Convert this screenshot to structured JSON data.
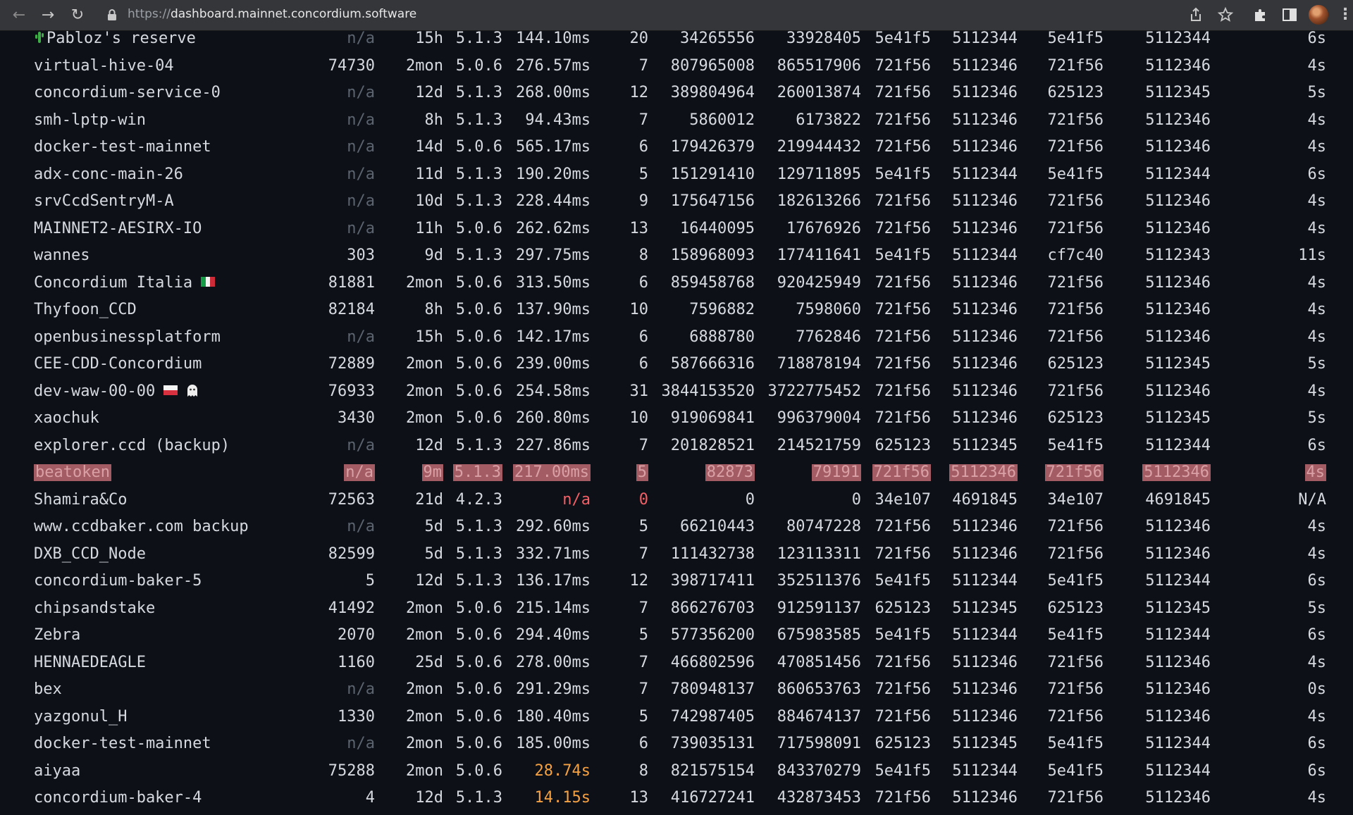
{
  "browser": {
    "url_scheme": "https://",
    "url_host": "dashboard.mainnet.concordium.software"
  },
  "table": {
    "rows": [
      {
        "name": "Pabloz's reserve",
        "icon": "cactus-icon",
        "id": "n/a",
        "uptime": "15h",
        "version": "5.1.3",
        "latency": "144.10ms",
        "peers": "20",
        "sent": "34265556",
        "received": "33928405",
        "best_block": "5e41f5",
        "best_height": "5112344",
        "final_block": "5e41f5",
        "final_height": "5112344",
        "age": "6s"
      },
      {
        "name": "virtual-hive-04",
        "id": "74730",
        "uptime": "2mon",
        "version": "5.0.6",
        "latency": "276.57ms",
        "peers": "7",
        "sent": "807965008",
        "received": "865517906",
        "best_block": "721f56",
        "best_height": "5112346",
        "final_block": "721f56",
        "final_height": "5112346",
        "age": "4s"
      },
      {
        "name": "concordium-service-0",
        "id": "n/a",
        "uptime": "12d",
        "version": "5.1.3",
        "latency": "268.00ms",
        "peers": "12",
        "sent": "389804964",
        "received": "260013874",
        "best_block": "721f56",
        "best_height": "5112346",
        "final_block": "625123",
        "final_height": "5112345",
        "age": "5s"
      },
      {
        "name": "smh-lptp-win",
        "id": "n/a",
        "uptime": "8h",
        "version": "5.1.3",
        "latency": "94.43ms",
        "peers": "7",
        "sent": "5860012",
        "received": "6173822",
        "best_block": "721f56",
        "best_height": "5112346",
        "final_block": "721f56",
        "final_height": "5112346",
        "age": "4s"
      },
      {
        "name": "docker-test-mainnet",
        "id": "n/a",
        "uptime": "14d",
        "version": "5.0.6",
        "latency": "565.17ms",
        "peers": "6",
        "sent": "179426379",
        "received": "219944432",
        "best_block": "721f56",
        "best_height": "5112346",
        "final_block": "721f56",
        "final_height": "5112346",
        "age": "4s"
      },
      {
        "name": "adx-conc-main-26",
        "id": "n/a",
        "uptime": "11d",
        "version": "5.1.3",
        "latency": "190.20ms",
        "peers": "5",
        "sent": "151291410",
        "received": "129711895",
        "best_block": "5e41f5",
        "best_height": "5112344",
        "final_block": "5e41f5",
        "final_height": "5112344",
        "age": "6s"
      },
      {
        "name": "srvCcdSentryM-A",
        "id": "n/a",
        "uptime": "10d",
        "version": "5.1.3",
        "latency": "228.44ms",
        "peers": "9",
        "sent": "175647156",
        "received": "182613266",
        "best_block": "721f56",
        "best_height": "5112346",
        "final_block": "721f56",
        "final_height": "5112346",
        "age": "4s"
      },
      {
        "name": "MAINNET2-AESIRX-IO",
        "id": "n/a",
        "uptime": "11h",
        "version": "5.0.6",
        "latency": "262.62ms",
        "peers": "13",
        "sent": "16440095",
        "received": "17676926",
        "best_block": "721f56",
        "best_height": "5112346",
        "final_block": "721f56",
        "final_height": "5112346",
        "age": "4s"
      },
      {
        "name": "wannes",
        "id": "303",
        "uptime": "9d",
        "version": "5.1.3",
        "latency": "297.75ms",
        "peers": "8",
        "sent": "158968093",
        "received": "177411641",
        "best_block": "5e41f5",
        "best_height": "5112344",
        "final_block": "cf7c40",
        "final_height": "5112343",
        "age": "11s"
      },
      {
        "name": "Concordium Italia",
        "flag": "italy-flag-icon",
        "id": "81881",
        "uptime": "2mon",
        "version": "5.0.6",
        "latency": "313.50ms",
        "peers": "6",
        "sent": "859458768",
        "received": "920425949",
        "best_block": "721f56",
        "best_height": "5112346",
        "final_block": "721f56",
        "final_height": "5112346",
        "age": "4s"
      },
      {
        "name": "Thyfoon_CCD",
        "id": "82184",
        "uptime": "8h",
        "version": "5.0.6",
        "latency": "137.90ms",
        "peers": "10",
        "sent": "7596882",
        "received": "7598060",
        "best_block": "721f56",
        "best_height": "5112346",
        "final_block": "721f56",
        "final_height": "5112346",
        "age": "4s"
      },
      {
        "name": "openbusinessplatform",
        "id": "n/a",
        "uptime": "15h",
        "version": "5.0.6",
        "latency": "142.17ms",
        "peers": "6",
        "sent": "6888780",
        "received": "7762846",
        "best_block": "721f56",
        "best_height": "5112346",
        "final_block": "721f56",
        "final_height": "5112346",
        "age": "4s"
      },
      {
        "name": "CEE-CDD-Concordium",
        "id": "72889",
        "uptime": "2mon",
        "version": "5.0.6",
        "latency": "239.00ms",
        "peers": "6",
        "sent": "587666316",
        "received": "718878194",
        "best_block": "721f56",
        "best_height": "5112346",
        "final_block": "625123",
        "final_height": "5112345",
        "age": "5s"
      },
      {
        "name": "dev-waw-00-00",
        "flag": "poland-flag-icon",
        "extra_icon": "ghost-icon",
        "id": "76933",
        "uptime": "2mon",
        "version": "5.0.6",
        "latency": "254.58ms",
        "peers": "31",
        "sent": "3844153520",
        "received": "3722775452",
        "best_block": "721f56",
        "best_height": "5112346",
        "final_block": "721f56",
        "final_height": "5112346",
        "age": "4s"
      },
      {
        "name": "xaochuk",
        "id": "3430",
        "uptime": "2mon",
        "version": "5.0.6",
        "latency": "260.80ms",
        "peers": "10",
        "sent": "919069841",
        "received": "996379004",
        "best_block": "721f56",
        "best_height": "5112346",
        "final_block": "625123",
        "final_height": "5112345",
        "age": "5s"
      },
      {
        "name": "explorer.ccd (backup)",
        "id": "n/a",
        "uptime": "12d",
        "version": "5.1.3",
        "latency": "227.86ms",
        "peers": "7",
        "sent": "201828521",
        "received": "214521759",
        "best_block": "625123",
        "best_height": "5112345",
        "final_block": "5e41f5",
        "final_height": "5112344",
        "age": "6s"
      },
      {
        "name": "beatoken",
        "highlight": true,
        "id": "n/a",
        "uptime": "9m",
        "version": "5.1.3",
        "latency": "217.00ms",
        "peers": "5",
        "sent": "82873",
        "received": "79191",
        "best_block": "721f56",
        "best_height": "5112346",
        "final_block": "721f56",
        "final_height": "5112346",
        "age": "4s"
      },
      {
        "name": "Shamira&Co",
        "id": "72563",
        "uptime": "21d",
        "version": "4.2.3",
        "latency": "n/a",
        "latency_style": "red",
        "peers": "0",
        "peers_style": "red",
        "sent": "0",
        "received": "0",
        "best_block": "34e107",
        "best_height": "4691845",
        "final_block": "34e107",
        "final_height": "4691845",
        "age": "N/A"
      },
      {
        "name": "www.ccdbaker.com backup",
        "id": "n/a",
        "uptime": "5d",
        "version": "5.1.3",
        "latency": "292.60ms",
        "peers": "5",
        "sent": "66210443",
        "received": "80747228",
        "best_block": "721f56",
        "best_height": "5112346",
        "final_block": "721f56",
        "final_height": "5112346",
        "age": "4s"
      },
      {
        "name": "DXB_CCD_Node",
        "id": "82599",
        "uptime": "5d",
        "version": "5.1.3",
        "latency": "332.71ms",
        "peers": "7",
        "sent": "111432738",
        "received": "123113311",
        "best_block": "721f56",
        "best_height": "5112346",
        "final_block": "721f56",
        "final_height": "5112346",
        "age": "4s"
      },
      {
        "name": "concordium-baker-5",
        "id": "5",
        "uptime": "12d",
        "version": "5.1.3",
        "latency": "136.17ms",
        "peers": "12",
        "sent": "398717411",
        "received": "352511376",
        "best_block": "5e41f5",
        "best_height": "5112344",
        "final_block": "5e41f5",
        "final_height": "5112344",
        "age": "6s"
      },
      {
        "name": "chipsandstake",
        "id": "41492",
        "uptime": "2mon",
        "version": "5.0.6",
        "latency": "215.14ms",
        "peers": "7",
        "sent": "866276703",
        "received": "912591137",
        "best_block": "625123",
        "best_height": "5112345",
        "final_block": "625123",
        "final_height": "5112345",
        "age": "5s"
      },
      {
        "name": "Zebra",
        "id": "2070",
        "uptime": "2mon",
        "version": "5.0.6",
        "latency": "294.40ms",
        "peers": "5",
        "sent": "577356200",
        "received": "675983585",
        "best_block": "5e41f5",
        "best_height": "5112344",
        "final_block": "5e41f5",
        "final_height": "5112344",
        "age": "6s"
      },
      {
        "name": "HENNAEDEAGLE",
        "id": "1160",
        "uptime": "25d",
        "version": "5.0.6",
        "latency": "278.00ms",
        "peers": "7",
        "sent": "466802596",
        "received": "470851456",
        "best_block": "721f56",
        "best_height": "5112346",
        "final_block": "721f56",
        "final_height": "5112346",
        "age": "4s"
      },
      {
        "name": "bex",
        "id": "n/a",
        "uptime": "2mon",
        "version": "5.0.6",
        "latency": "291.29ms",
        "peers": "7",
        "sent": "780948137",
        "received": "860653763",
        "best_block": "721f56",
        "best_height": "5112346",
        "final_block": "721f56",
        "final_height": "5112346",
        "age": "0s"
      },
      {
        "name": "yazgonul_H",
        "id": "1330",
        "uptime": "2mon",
        "version": "5.0.6",
        "latency": "180.40ms",
        "peers": "5",
        "sent": "742987405",
        "received": "884674137",
        "best_block": "721f56",
        "best_height": "5112346",
        "final_block": "721f56",
        "final_height": "5112346",
        "age": "4s"
      },
      {
        "name": "docker-test-mainnet",
        "id": "n/a",
        "uptime": "2mon",
        "version": "5.0.6",
        "latency": "185.00ms",
        "peers": "6",
        "sent": "739035131",
        "received": "717598091",
        "best_block": "625123",
        "best_height": "5112345",
        "final_block": "5e41f5",
        "final_height": "5112344",
        "age": "6s"
      },
      {
        "name": "aiyaa",
        "id": "75288",
        "uptime": "2mon",
        "version": "5.0.6",
        "latency": "28.74s",
        "latency_style": "orange",
        "peers": "8",
        "sent": "821575154",
        "received": "843370279",
        "best_block": "5e41f5",
        "best_height": "5112344",
        "final_block": "5e41f5",
        "final_height": "5112344",
        "age": "6s"
      },
      {
        "name": "concordium-baker-4",
        "id": "4",
        "uptime": "12d",
        "version": "5.1.3",
        "latency": "14.15s",
        "latency_style": "orange",
        "peers": "13",
        "sent": "416727241",
        "received": "432873453",
        "best_block": "721f56",
        "best_height": "5112346",
        "final_block": "721f56",
        "final_height": "5112346",
        "age": "4s"
      }
    ]
  },
  "colors": {
    "background": "#0d1117",
    "text": "#d6dae0",
    "muted": "#5c6470",
    "error_red": "#f25f66",
    "warning_orange": "#f5a142",
    "highlight_bg": "#a35c63"
  }
}
